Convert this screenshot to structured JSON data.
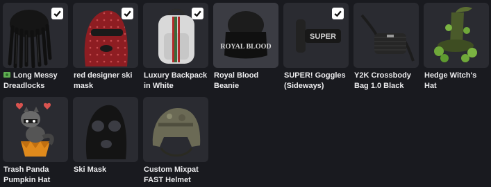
{
  "items": [
    {
      "name": "Long Messy Dreadlocks",
      "equipped": true,
      "badge": "money-icon"
    },
    {
      "name": "red designer ski mask",
      "equipped": true
    },
    {
      "name": "Luxury Backpack in White",
      "equipped": true
    },
    {
      "name": "Royal Blood Beanie",
      "equipped": false,
      "highlighted": true,
      "print": "ROYAL BLOOD"
    },
    {
      "name": "SUPER! Goggles (Sideways)",
      "equipped": true,
      "print": "SUPER"
    },
    {
      "name": "Y2K Crossbody Bag 1.0 Black",
      "equipped": false
    },
    {
      "name": "Hedge Witch's Hat",
      "equipped": false
    },
    {
      "name": "Trash Panda Pumpkin Hat",
      "equipped": false
    },
    {
      "name": "Ski Mask",
      "equipped": false
    },
    {
      "name": "Custom Mixpat FAST Helmet",
      "equipped": false
    }
  ],
  "colors": {
    "background": "#191a1f",
    "tile": "#2a2b31",
    "tile_selected": "#3b3c43",
    "check": "#ffffff"
  }
}
